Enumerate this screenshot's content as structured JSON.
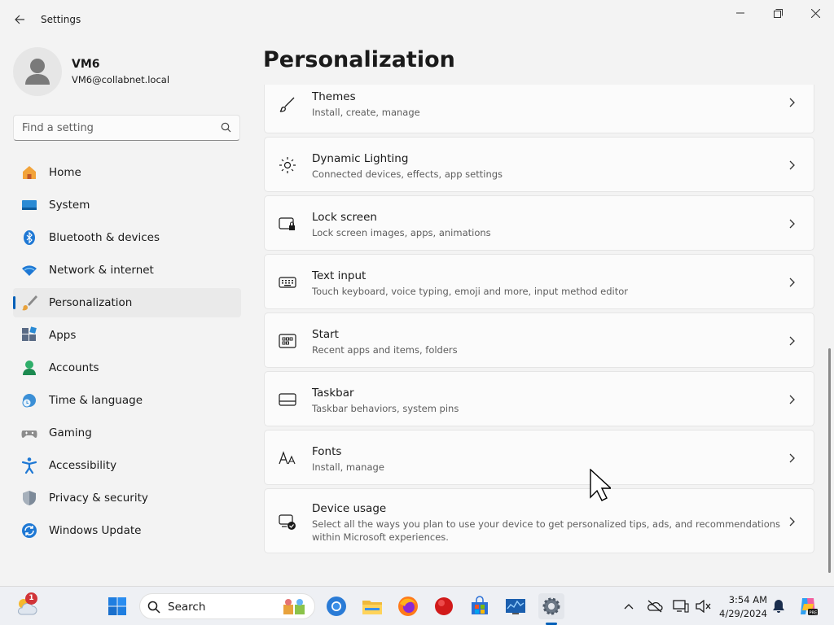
{
  "app": {
    "title": "Settings"
  },
  "profile": {
    "name": "VM6",
    "email": "VM6@collabnet.local"
  },
  "search": {
    "placeholder": "Find a setting"
  },
  "sidebar": {
    "items": [
      {
        "label": "Home",
        "icon": "home-icon"
      },
      {
        "label": "System",
        "icon": "system-icon"
      },
      {
        "label": "Bluetooth & devices",
        "icon": "bluetooth-icon"
      },
      {
        "label": "Network & internet",
        "icon": "wifi-icon"
      },
      {
        "label": "Personalization",
        "icon": "paintbrush-icon",
        "active": true
      },
      {
        "label": "Apps",
        "icon": "apps-icon"
      },
      {
        "label": "Accounts",
        "icon": "accounts-icon"
      },
      {
        "label": "Time & language",
        "icon": "clock-globe-icon"
      },
      {
        "label": "Gaming",
        "icon": "gamepad-icon"
      },
      {
        "label": "Accessibility",
        "icon": "accessibility-icon"
      },
      {
        "label": "Privacy & security",
        "icon": "shield-icon"
      },
      {
        "label": "Windows Update",
        "icon": "update-icon"
      }
    ]
  },
  "main": {
    "title": "Personalization",
    "cards": [
      {
        "title": "Themes",
        "desc": "Install, create, manage",
        "icon": "brush-icon"
      },
      {
        "title": "Dynamic Lighting",
        "desc": "Connected devices, effects, app settings",
        "icon": "lighting-icon"
      },
      {
        "title": "Lock screen",
        "desc": "Lock screen images, apps, animations",
        "icon": "lock-screen-icon"
      },
      {
        "title": "Text input",
        "desc": "Touch keyboard, voice typing, emoji and more, input method editor",
        "icon": "keyboard-icon"
      },
      {
        "title": "Start",
        "desc": "Recent apps and items, folders",
        "icon": "start-icon"
      },
      {
        "title": "Taskbar",
        "desc": "Taskbar behaviors, system pins",
        "icon": "taskbar-icon"
      },
      {
        "title": "Fonts",
        "desc": "Install, manage",
        "icon": "fonts-icon"
      },
      {
        "title": "Device usage",
        "desc": "Select all the ways you plan to use your device to get personalized tips, ads, and recommendations within Microsoft experiences.",
        "icon": "device-usage-icon"
      }
    ]
  },
  "taskbar": {
    "search_label": "Search",
    "weather_badge": "1",
    "time": "3:54 AM",
    "date": "4/29/2024"
  },
  "colors": {
    "accent": "#005fb8",
    "badge": "#d13438"
  }
}
